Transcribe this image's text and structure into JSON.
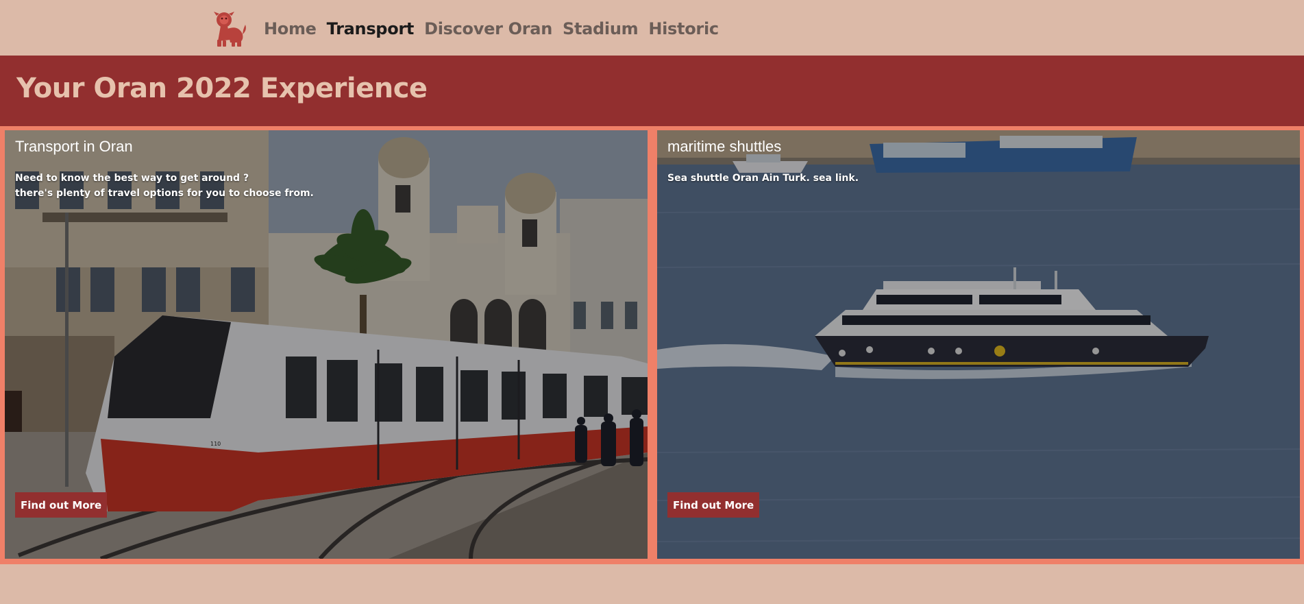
{
  "nav": {
    "logo_icon": "lion-logo-icon",
    "links": [
      {
        "label": "Home",
        "active": false
      },
      {
        "label": "Transport",
        "active": true
      },
      {
        "label": "Discover Oran",
        "active": false
      },
      {
        "label": "Stadium",
        "active": false
      },
      {
        "label": "Historic",
        "active": false
      }
    ]
  },
  "hero": {
    "title": "Your Oran 2022 Experience"
  },
  "cards": [
    {
      "title": "Transport in Oran",
      "description_lines": [
        "Need to know the best way to get around ?",
        "there's plenty of travel options for you to choose from."
      ],
      "button_label": "Find out More"
    },
    {
      "title": "maritime shuttles",
      "description_lines": [
        "Sea shuttle Oran Ain Turk. sea link."
      ],
      "button_label": "Find out More"
    }
  ],
  "colors": {
    "page_background": "#dcbaa8",
    "hero_background": "#922f2f",
    "hero_text": "#e6c2ad",
    "card_frame": "#ef8068",
    "button_background": "#922f2f",
    "nav_active": "#1b1b1b",
    "nav_inactive": "#6b5d57"
  }
}
